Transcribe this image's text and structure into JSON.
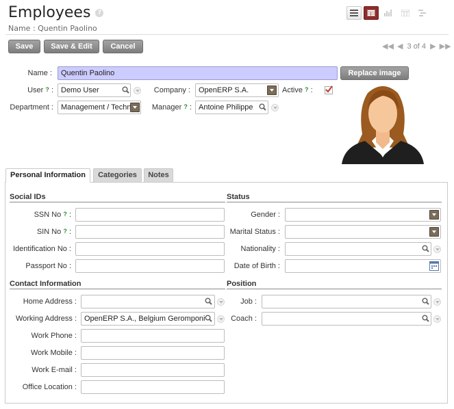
{
  "header": {
    "title": "Employees",
    "help": "?",
    "subtitle": "Name : Quentin Paolino"
  },
  "views": [
    "list-view",
    "form-view",
    "graph-view",
    "calendar-view",
    "gantt-view"
  ],
  "toolbar": {
    "save_label": "Save",
    "save_edit_label": "Save & Edit",
    "cancel_label": "Cancel",
    "pager_text": "3 of 4"
  },
  "form": {
    "name_label": "Name :",
    "name_value": "Quentin Paolino",
    "replace_image_label": "Replace image",
    "user_label": "User",
    "user_value": "Demo User",
    "company_label": "Company :",
    "company_value": "OpenERP S.A.",
    "active_label": "Active",
    "active_checked": true,
    "department_label": "Department :",
    "department_value": "Management / Techn",
    "manager_label": "Manager",
    "manager_value": "Antoine Philippe",
    "help_mark": "?",
    "colon": ":"
  },
  "tabs": [
    {
      "label": "Personal Information",
      "active": true
    },
    {
      "label": "Categories",
      "active": false
    },
    {
      "label": "Notes",
      "active": false
    }
  ],
  "personal": {
    "social_ids_title": "Social IDs",
    "ssn_label": "SSN No",
    "sin_label": "SIN No",
    "identification_label": "Identification No :",
    "passport_label": "Passport No :",
    "status_title": "Status",
    "gender_label": "Gender :",
    "marital_label": "Marital Status :",
    "nationality_label": "Nationality :",
    "dob_label": "Date of Birth :",
    "contact_title": "Contact Information",
    "home_address_label": "Home Address :",
    "working_address_label": "Working Address :",
    "working_address_value": "OpenERP S.A., Belgium Geromponi",
    "work_phone_label": "Work Phone :",
    "work_mobile_label": "Work Mobile :",
    "work_email_label": "Work E-mail :",
    "office_location_label": "Office Location :",
    "position_title": "Position",
    "job_label": "Job :",
    "coach_label": "Coach :"
  },
  "colors": {
    "highlight_field": "#ccccff",
    "active_view": "#8b2e2b",
    "button_grey": "#8f8f8f",
    "help_green": "#2e8b2e",
    "checkbox_red": "#c0392b"
  }
}
